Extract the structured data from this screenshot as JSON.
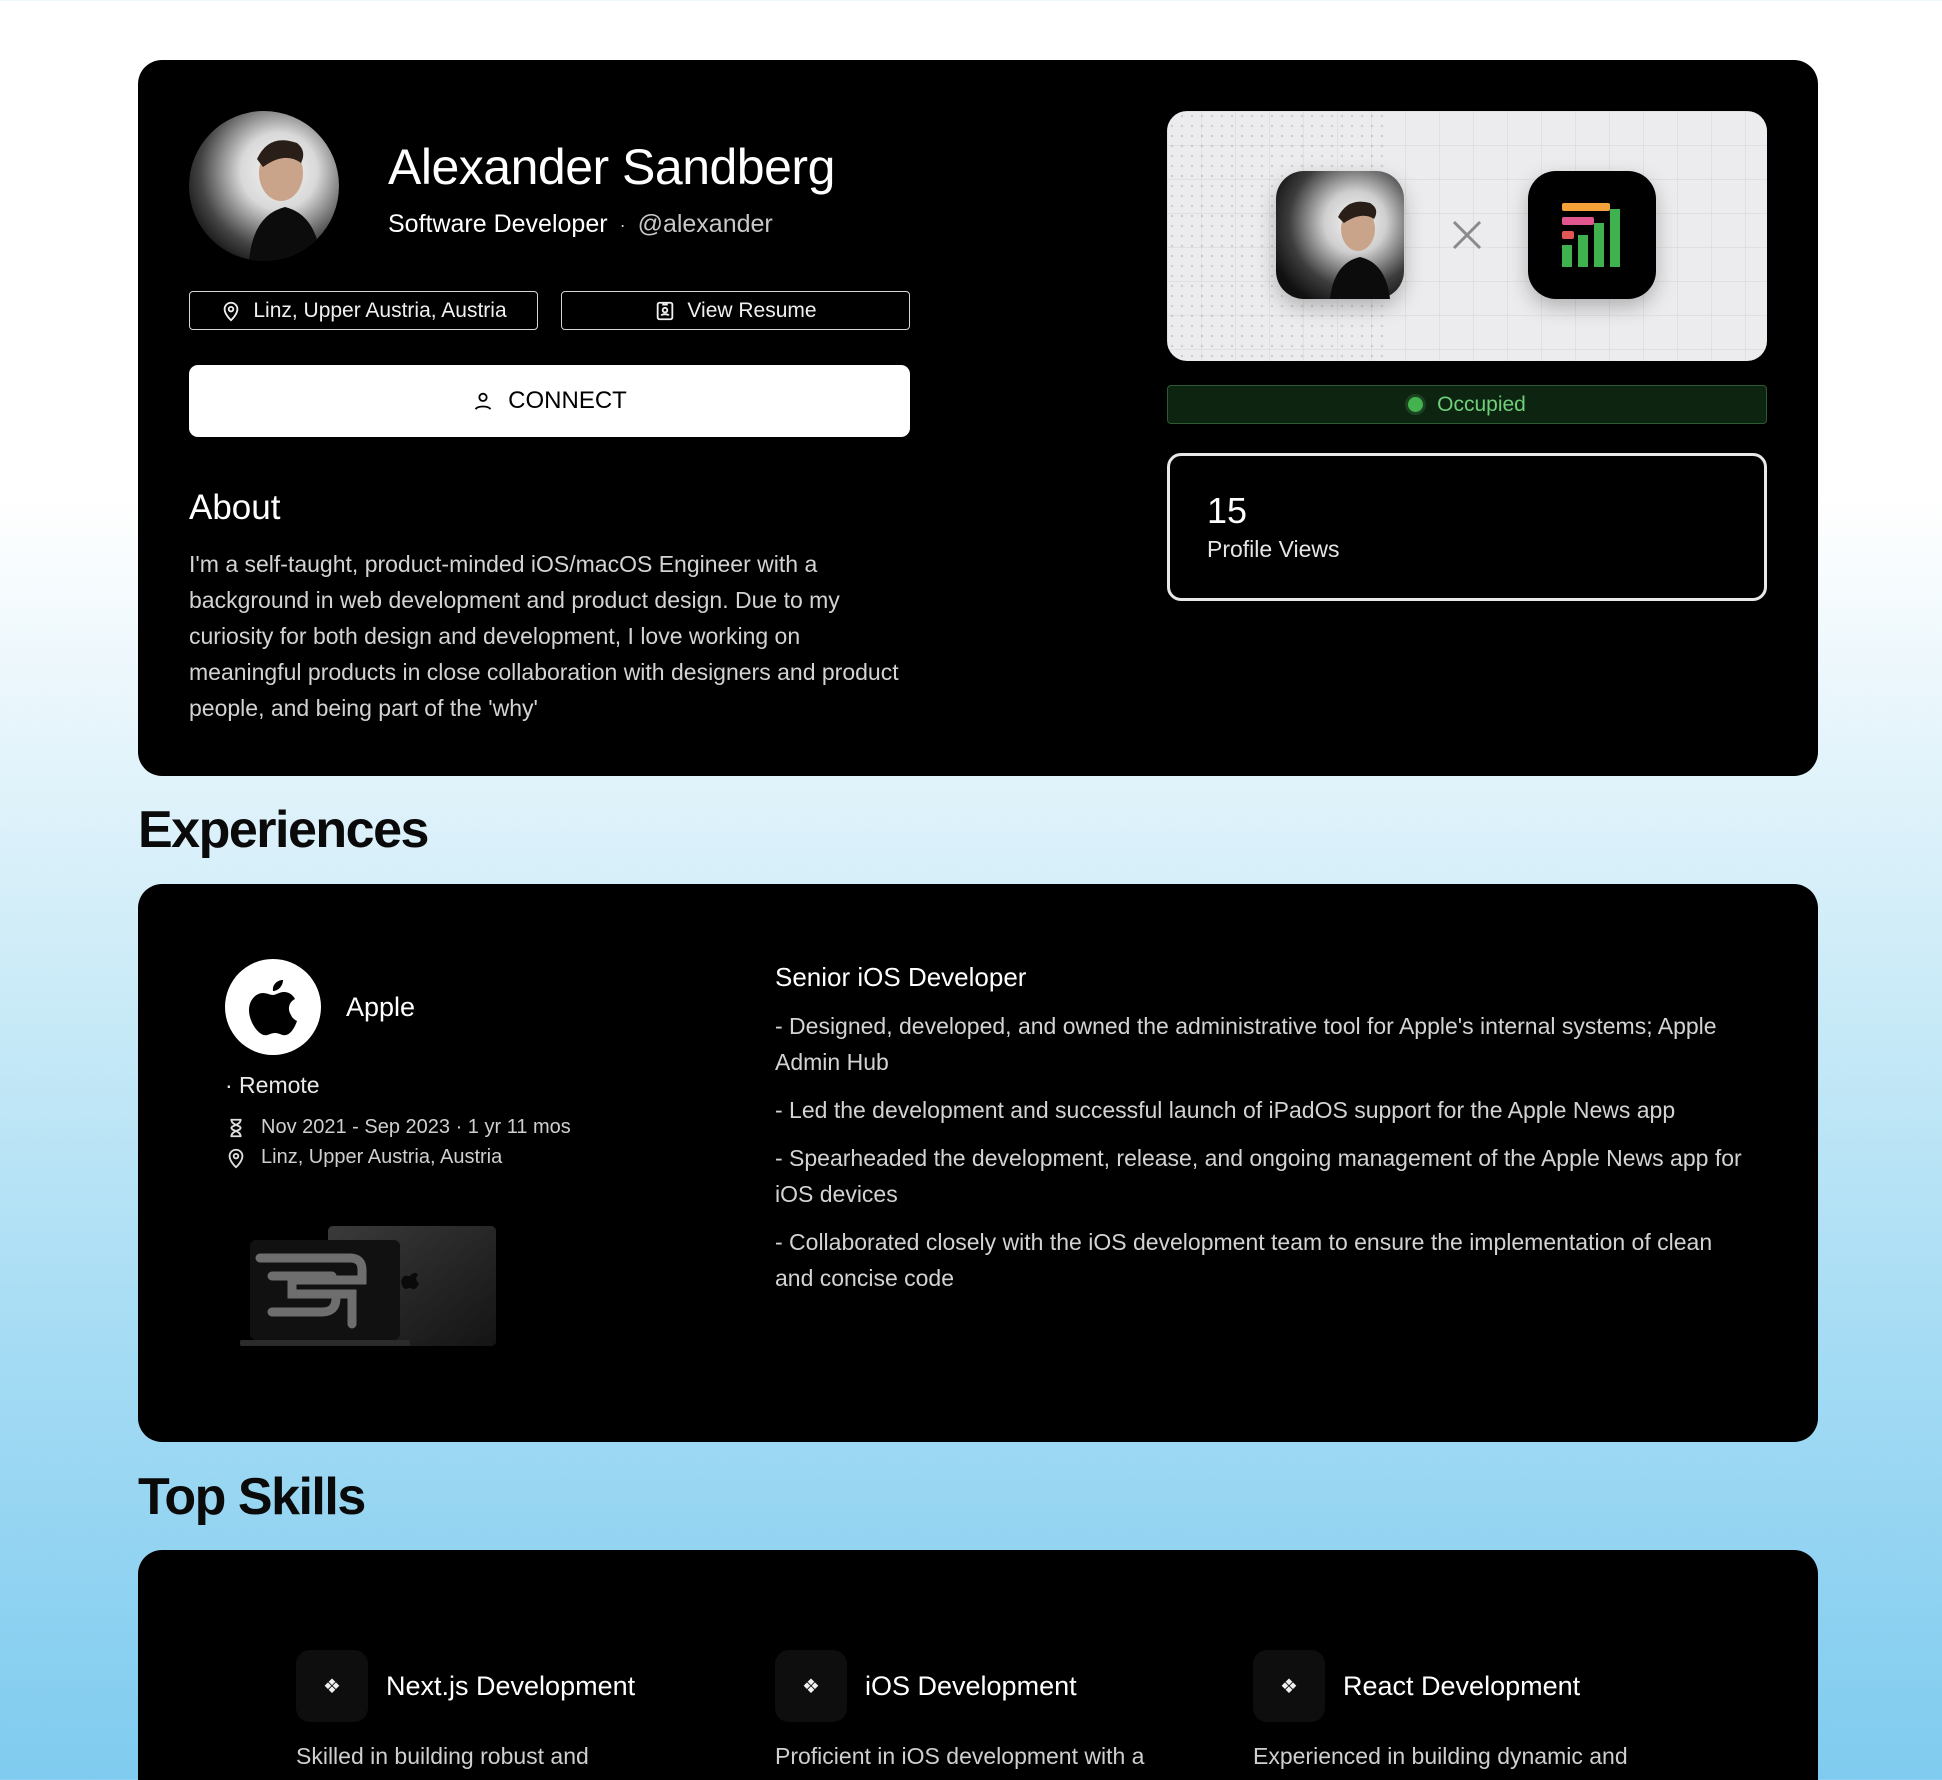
{
  "profile": {
    "name": "Alexander Sandberg",
    "role": "Software Developer",
    "separator": "·",
    "handle": "@alexander",
    "location_chip": "Linz, Upper Austria, Austria",
    "resume_chip": "View Resume",
    "connect_label": "CONNECT",
    "about_title": "About",
    "about_text": "I'm a self-taught, product-minded iOS/macOS Engineer with a background in web development and product design. Due to my curiosity for both design and development, I love working on meaningful products in close collaboration with designers and product people, and being part of the 'why'",
    "status": "Occupied",
    "status_color": "#43b34f",
    "views_count": "15",
    "views_label": "Profile Views"
  },
  "sections": {
    "experiences_title": "Experiences",
    "skills_title": "Top Skills"
  },
  "experience": {
    "company": "Apple",
    "work_mode": "· Remote",
    "dates": "Nov 2021 - Sep 2023 · 1 yr 11 mos",
    "location": "Linz, Upper Austria, Austria",
    "role": "Senior iOS Developer",
    "bullets": [
      "- Designed, developed, and owned the administrative tool for Apple's internal systems; Apple Admin Hub",
      "- Led the development and successful launch of iPadOS support for the Apple News app",
      "- Spearheaded the development, release, and ongoing management of the Apple News app for iOS devices",
      "- Collaborated closely with the iOS development team to ensure the implementation of clean and concise code"
    ]
  },
  "skills": [
    {
      "icon": "❖",
      "title": "Next.js Development",
      "desc": "Skilled in building robust and"
    },
    {
      "icon": "❖",
      "title": "iOS Development",
      "desc": "Proficient in iOS development with a"
    },
    {
      "icon": "❖",
      "title": "React Development",
      "desc": "Experienced in building dynamic and"
    }
  ],
  "colors": {
    "app_bar_orange": "#f5a13a",
    "app_bar_pink": "#e2568f",
    "app_bar_green": "#3fb24f"
  }
}
